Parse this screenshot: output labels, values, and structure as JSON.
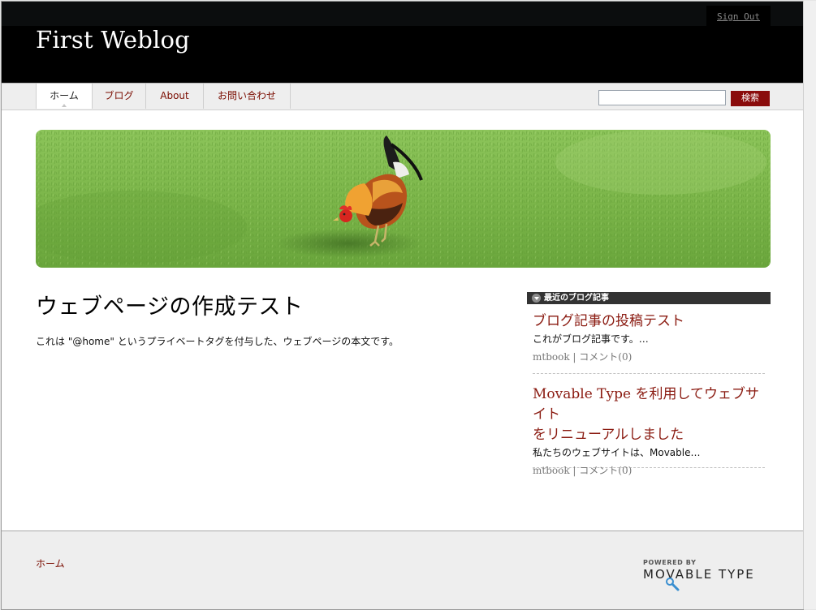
{
  "header": {
    "site_title": "First Weblog",
    "signout_label": "Sign Out"
  },
  "nav": {
    "tabs": [
      {
        "label": "ホーム",
        "active": true
      },
      {
        "label": "ブログ",
        "active": false
      },
      {
        "label": "About",
        "active": false
      },
      {
        "label": "お問い合わせ",
        "active": false
      }
    ],
    "search_value": "",
    "search_button_label": "検索"
  },
  "main": {
    "page_title": "ウェブページの作成テスト",
    "body_text": "これは \"@home\" というプライベートタグを付与した、ウェブページの本文です。"
  },
  "sidebar": {
    "widget_title": "最近のブログ記事",
    "entries": [
      {
        "title_line1": "ブログ記事の投稿テスト",
        "title_line2": "",
        "excerpt": "これがブログ記事です。…",
        "author": "mtbook",
        "comments": "コメント(0)"
      },
      {
        "title_line1": "Movable Type を利用してウェブサイト",
        "title_line2": "をリニューアルしました",
        "excerpt": "私たちのウェブサイトは、Movable…",
        "author": "mtbook",
        "comments": "コメント(0)"
      }
    ]
  },
  "footer": {
    "home_link": "ホーム",
    "powered_by": "POWERED BY",
    "brand": "MOVABLE TYPE"
  },
  "colors": {
    "header_bg": "#000000",
    "link_red": "#7a0c00",
    "button_red": "#8a0c0c",
    "grass": "#7fb94a"
  }
}
